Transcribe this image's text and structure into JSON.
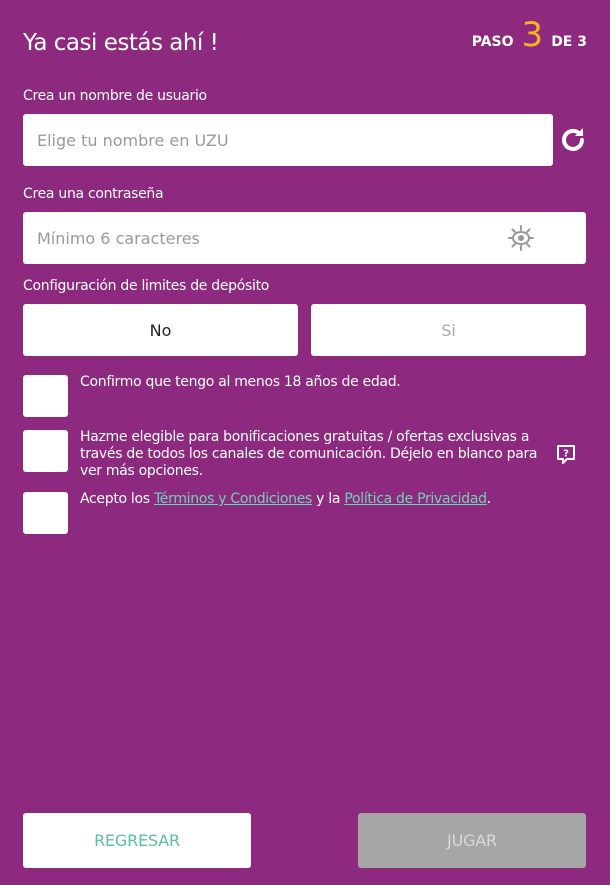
{
  "header": {
    "title": "Ya casi estás ahí !",
    "step_prefix": "PASO",
    "step_number": "3",
    "step_suffix": "DE 3"
  },
  "username": {
    "label": "Crea un nombre de usuario",
    "placeholder": "Elige tu nombre en UZU",
    "refresh_icon": "refresh-icon"
  },
  "password": {
    "label": "Crea una contraseña",
    "placeholder": "Mínimo 6 caracteres",
    "toggle_icon": "eye-icon"
  },
  "deposit": {
    "label": "Configuración de limites de depósito",
    "options": [
      "No",
      "Si"
    ],
    "selected": "No"
  },
  "checkboxes": {
    "age": "Confirmo que tengo al menos 18 años de edad.",
    "bonus_line1": "Hazme elegible para bonificaciones gratuitas / ofertas exclusivas a",
    "bonus_line2": "través de todos los canales de comunicación. Déjelo en blanco para",
    "bonus_line3": "ver más opciones.",
    "terms_prefix": "Acepto los ",
    "terms_link": "Términos y Condiciones",
    "terms_middle": " y la ",
    "privacy_link": "Política de Privacidad",
    "terms_suffix": "."
  },
  "buttons": {
    "back": "REGRESAR",
    "play": "JUGAR"
  },
  "colors": {
    "background": "#8d2a80",
    "accent": "#f6b21b",
    "link": "#6ed3b4",
    "disabled": "#a6a6a6"
  }
}
